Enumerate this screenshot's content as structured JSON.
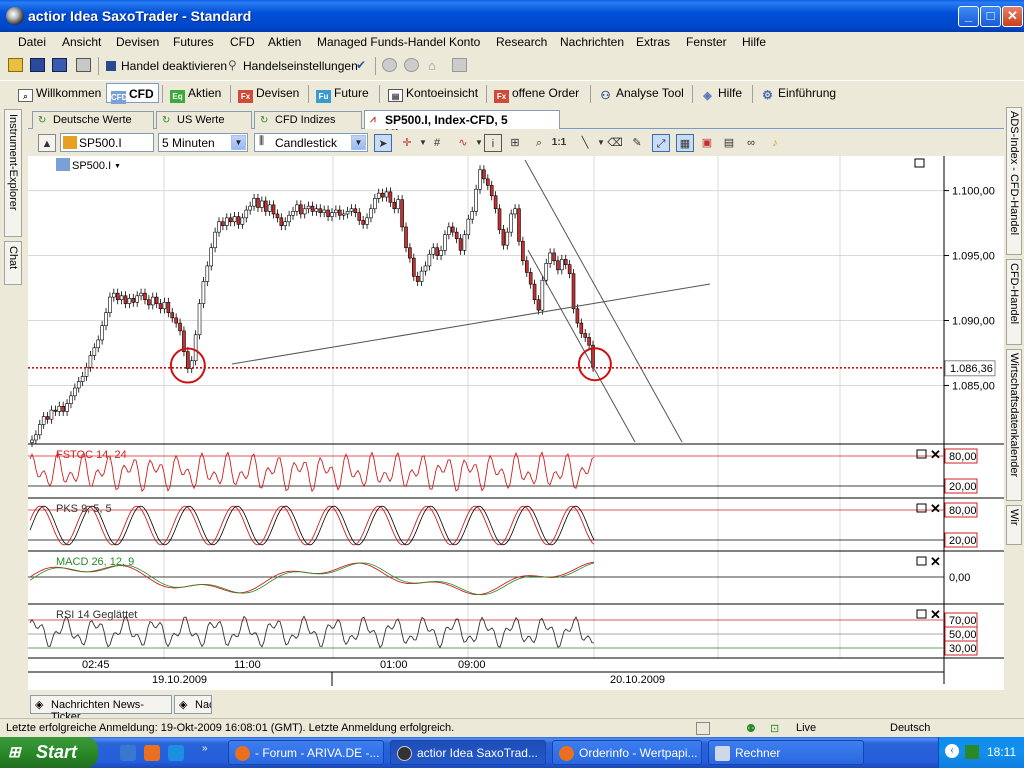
{
  "window": {
    "title": "actior Idea SaxoTrader - Standard"
  },
  "menu": [
    "Datei",
    "Ansicht",
    "Devisen",
    "Futures",
    "CFD",
    "Aktien",
    "Managed Funds-Handel",
    "Konto",
    "Research",
    "Nachrichten",
    "Extras",
    "Fenster",
    "Hilfe"
  ],
  "toolbar1": {
    "handel_deaktivieren": "Handel deaktivieren",
    "handelseinstellungen": "Handelseinstellungen"
  },
  "modules": [
    {
      "label": "Willkommen",
      "icon_text": ""
    },
    {
      "label": "CFD",
      "icon_text": "CFD"
    },
    {
      "label": "Aktien",
      "icon_text": "Eq"
    },
    {
      "label": "Devisen",
      "icon_text": "Fx"
    },
    {
      "label": "Future",
      "icon_text": "Fu"
    },
    {
      "label": "Kontoeinsicht",
      "icon_text": ""
    },
    {
      "label": "offene Order",
      "icon_text": "Fx"
    },
    {
      "label": "Analyse Tool",
      "icon_text": ""
    },
    {
      "label": "Hilfe",
      "icon_text": ""
    },
    {
      "label": "Einführung",
      "icon_text": ""
    }
  ],
  "left_panel": {
    "explorer": "Instrument-Explorer",
    "chat": "Chat"
  },
  "right_panel": {
    "tab1": "ADS-Index - CFD-Handel",
    "tab2": "CFD-Handel",
    "tab3": "Wirtschaftsdatenkalender",
    "tab4": "Wir"
  },
  "doc_tabs": [
    "Deutsche Werte",
    "US Werte",
    "CFD Indizes",
    "SP500.I, Index-CFD, 5 Minuten"
  ],
  "chart_toolbar": {
    "instrument": "SP500.I",
    "interval": "5 Minuten",
    "chart_type": "Candlestick",
    "one_to_one": "1:1"
  },
  "chart_data": {
    "type": "candlestick",
    "instrument_label": "SP500.I",
    "current_price_label": "1.086,36",
    "current_price": 1086.36,
    "price_axis": {
      "ticks": [
        1100,
        1095,
        1090,
        1085
      ],
      "tick_labels": [
        "1.100,00",
        "1.095,00",
        "1.090,00",
        "1.085,00"
      ],
      "range": [
        1080.8,
        1102.2
      ]
    },
    "x_tick_labels": [
      "02:45",
      "11:00",
      "01:00",
      "09:00"
    ],
    "date_labels": [
      "19.10.2009",
      "20.10.2009"
    ],
    "close_series": [
      1080.8,
      1081.2,
      1082.0,
      1082.6,
      1082.4,
      1083.1,
      1083.0,
      1083.4,
      1083.0,
      1083.6,
      1084.2,
      1084.8,
      1085.3,
      1085.7,
      1086.4,
      1087.3,
      1087.9,
      1088.5,
      1089.6,
      1090.6,
      1091.8,
      1092.1,
      1091.6,
      1091.9,
      1091.3,
      1091.7,
      1091.4,
      1091.9,
      1092.1,
      1091.6,
      1091.2,
      1091.8,
      1091.3,
      1090.9,
      1091.4,
      1090.6,
      1090.2,
      1089.8,
      1089.2,
      1087.6,
      1086.3,
      1086.9,
      1088.9,
      1091.3,
      1093.0,
      1094.2,
      1095.6,
      1096.8,
      1097.6,
      1097.3,
      1097.9,
      1097.6,
      1098.0,
      1097.4,
      1097.9,
      1098.5,
      1098.8,
      1099.4,
      1098.7,
      1099.2,
      1098.4,
      1098.9,
      1098.2,
      1097.9,
      1097.3,
      1097.6,
      1098.1,
      1098.4,
      1098.9,
      1098.2,
      1098.6,
      1098.8,
      1098.4,
      1098.6,
      1098.3,
      1098.5,
      1098.0,
      1098.3,
      1098.5,
      1098.1,
      1098.2,
      1098.4,
      1098.6,
      1098.3,
      1097.7,
      1097.4,
      1097.9,
      1098.6,
      1099.4,
      1099.8,
      1099.5,
      1099.9,
      1099.1,
      1098.6,
      1099.3,
      1097.2,
      1095.6,
      1094.8,
      1093.4,
      1093.0,
      1093.8,
      1094.2,
      1095.1,
      1095.6,
      1095.0,
      1095.4,
      1096.6,
      1097.2,
      1096.8,
      1096.3,
      1095.4,
      1096.6,
      1097.8,
      1098.4,
      1100.1,
      1101.6,
      1100.9,
      1100.4,
      1099.6,
      1098.6,
      1097.0,
      1095.8,
      1096.8,
      1098.2,
      1098.6,
      1096.1,
      1094.6,
      1093.7,
      1092.8,
      1091.6,
      1090.8,
      1093.1,
      1094.4,
      1095.2,
      1094.6,
      1093.9,
      1094.7,
      1094.3,
      1093.6,
      1090.9,
      1089.8,
      1089.0,
      1088.7,
      1088.1,
      1086.4
    ],
    "annotations": {
      "circles": [
        {
          "at_index": 40,
          "price": 1086.3
        },
        {
          "at_index": 145,
          "price": 1086.4
        }
      ],
      "price_line": 1086.36
    },
    "indicators": [
      {
        "name": "FSTOC 14, 24",
        "levels_labels": [
          "80,00",
          "20,00"
        ]
      },
      {
        "name": "PKS 9, 5, 5",
        "levels_labels": [
          "80,00",
          "20,00"
        ]
      },
      {
        "name": "MACD 26, 12, 9",
        "levels_labels": [
          "0,00"
        ]
      },
      {
        "name": "RSI 14 Geglättet",
        "levels_labels": [
          "70,00",
          "50,00",
          "30,00"
        ]
      }
    ]
  },
  "bottom_tabs": [
    "Nachrichten News-Ticker",
    "Nac"
  ],
  "statusbar": {
    "message": "Letzte erfolgreiche Anmeldung: 19-Okt-2009 16:08:01 (GMT). Letzte Anmeldung erfolgreich.",
    "live": "Live",
    "language": "Deutsch"
  },
  "taskbar": {
    "start": "Start",
    "items": [
      "- Forum - ARIVA.DE -...",
      "actior Idea SaxoTrad...",
      "Orderinfo - Wertpapi...",
      "Rechner"
    ],
    "clock": "18:11"
  }
}
